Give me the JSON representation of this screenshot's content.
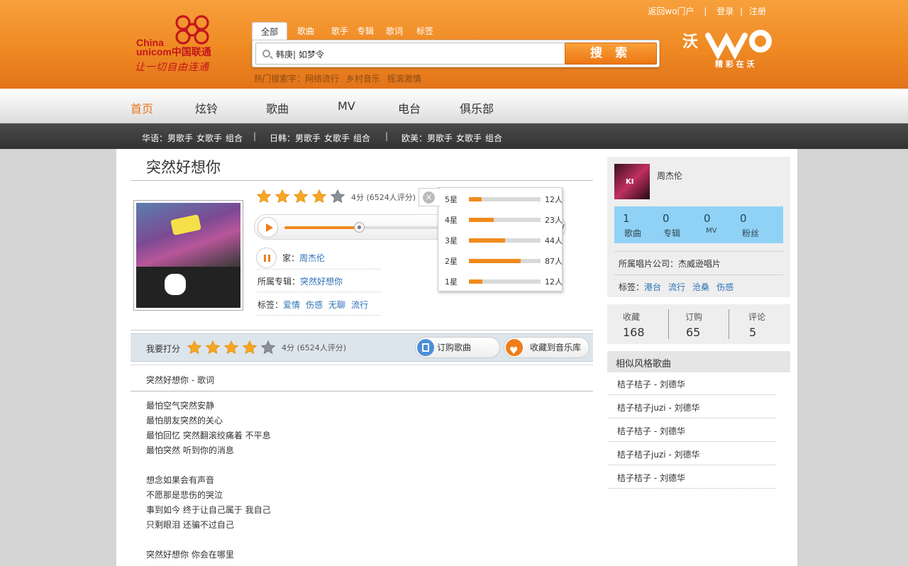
{
  "header": {
    "logo_en_1": "China",
    "logo_en_2": "unicom中国联通",
    "logo_slogan": "让一切自由连通",
    "top_links": [
      "返回wo门户",
      "登录",
      "注册"
    ],
    "top_sep": "|",
    "search_tabs": [
      "全部",
      "歌曲",
      "歌手",
      "专辑",
      "歌词",
      "标签"
    ],
    "search_value": "韩庚| 如梦令",
    "search_button": "搜 索",
    "hot_label": "热门搜索字：",
    "hot_terms": [
      "网络流行",
      "乡村音乐",
      "摇滚激情"
    ],
    "wo_tagline": "精 彩 在 沃",
    "wo_text": "沃"
  },
  "nav": {
    "items": [
      "首页",
      "炫铃",
      "歌曲",
      "MV",
      "电台",
      "俱乐部"
    ],
    "active": 0
  },
  "subnav": {
    "groups": [
      {
        "label": "华语：",
        "items": [
          "男歌手",
          "女歌手",
          "组合"
        ]
      },
      {
        "label": "日韩：",
        "items": [
          "男歌手",
          "女歌手",
          "组合"
        ]
      },
      {
        "label": "欧美：",
        "items": [
          "男歌手",
          "女歌手",
          "组合"
        ]
      }
    ],
    "sep": "|"
  },
  "song": {
    "title": "突然好想你",
    "rating_stars": 4,
    "rating_text": "4分 (6524人评分)",
    "progress": 0.35,
    "player_tail": "v",
    "singer_label": "歌手：",
    "singer_label_visible": "家：",
    "singer": "周杰伦",
    "album_label": "所属专辑：",
    "album": "突然好想你",
    "tags_label": "标签：",
    "tags": [
      "爱情",
      "伤感",
      "无聊",
      "流行"
    ]
  },
  "rating_popup": {
    "close": "×",
    "rows": [
      {
        "label": "5星",
        "fraction": 0.18,
        "count": "12人"
      },
      {
        "label": "4星",
        "fraction": 0.35,
        "count": "23人"
      },
      {
        "label": "3星",
        "fraction": 0.5,
        "count": "44人"
      },
      {
        "label": "2星",
        "fraction": 0.72,
        "count": "87人"
      },
      {
        "label": "1星",
        "fraction": 0.19,
        "count": "12人"
      }
    ]
  },
  "rate_bar": {
    "label": "我要打分",
    "stars": 4,
    "text": "4分 (6524人评分)",
    "subscribe": "订购歌曲",
    "favorite": "收藏到音乐库"
  },
  "lyrics": {
    "header": "突然好想你 - 歌词",
    "lines": [
      "最怕空气突然安静",
      "最怕朋友突然的关心",
      "最怕回忆 突然翻滚绞痛着 不平息",
      "最怕突然 听到你的消息",
      "",
      "想念如果会有声音",
      "不愿那是悲伤的哭泣",
      "事到如今 终于让自己属于 我自己",
      "只剩眼泪 还骗不过自己",
      "",
      "突然好想你 你会在哪里"
    ]
  },
  "artist": {
    "name": "周杰伦",
    "stats": [
      {
        "num": "1",
        "label": "歌曲"
      },
      {
        "num": "0",
        "label": "专辑"
      },
      {
        "num": "0",
        "label": "MV"
      },
      {
        "num": "0",
        "label": "粉丝"
      }
    ],
    "company_label": "所属唱片公司：",
    "company": "杰威逊唱片",
    "tags_label": "标签：",
    "tags": [
      "港台",
      "流行",
      "沧桑",
      "伤感"
    ]
  },
  "counts": [
    {
      "label": "收藏",
      "num": "168"
    },
    {
      "label": "订购",
      "num": "65"
    },
    {
      "label": "评论",
      "num": "5"
    }
  ],
  "similar": {
    "title": "相似风格歌曲",
    "items": [
      "桔子桔子 - 刘德华",
      "桔子桔子juzi - 刘德华",
      "桔子桔子 - 刘德华",
      "桔子桔子juzi - 刘德华",
      "桔子桔子 - 刘德华"
    ]
  },
  "colors": {
    "accent": "#ef8a23",
    "link": "#2c72b8",
    "stats_blue": "#8fd2f5"
  }
}
